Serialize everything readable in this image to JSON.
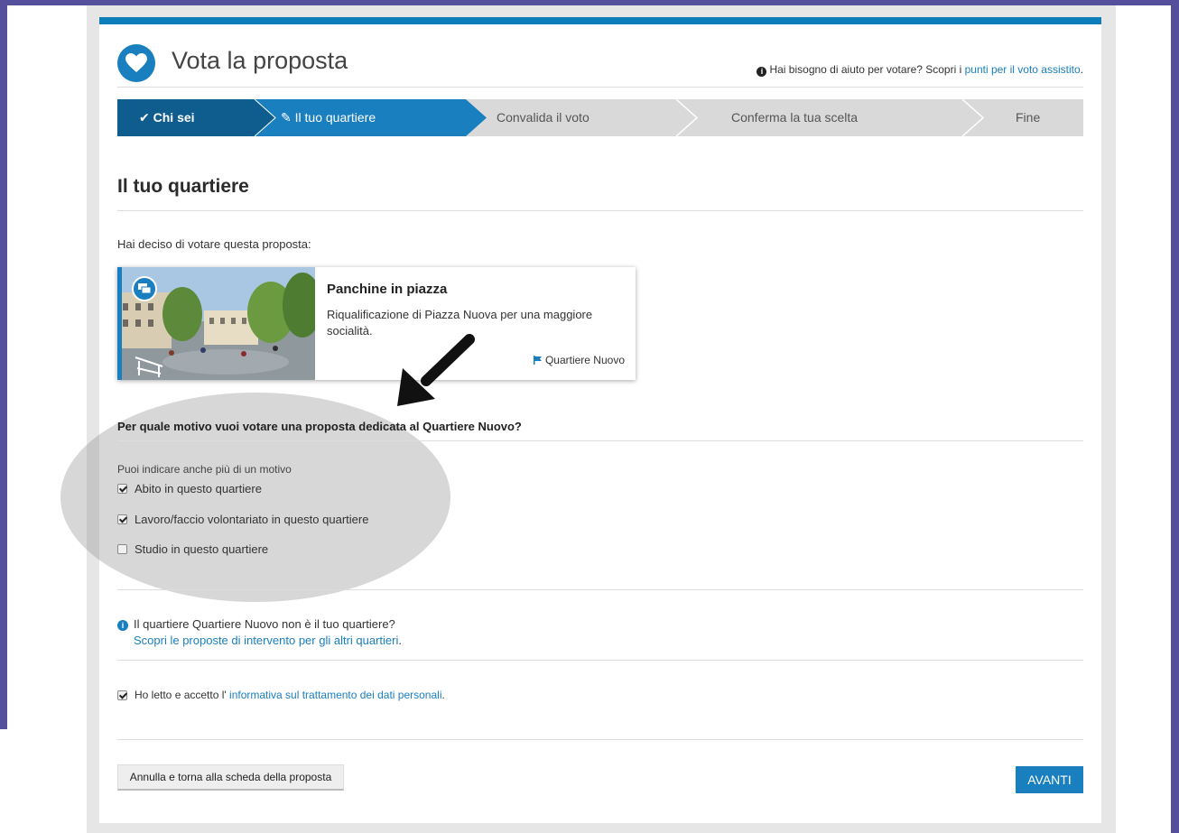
{
  "header": {
    "title": "Vota la proposta",
    "help_text": "Hai bisogno di aiuto per votare? Scopri i ",
    "help_link": "punti per il voto assistito",
    "help_suffix": "."
  },
  "steps": [
    {
      "label": "Chi sei",
      "state": "done"
    },
    {
      "label": "Il tuo quartiere",
      "state": "current"
    },
    {
      "label": "Convalida il voto",
      "state": "todo"
    },
    {
      "label": "Conferma la tua scelta",
      "state": "todo"
    },
    {
      "label": "Fine",
      "state": "todo"
    }
  ],
  "section_title": "Il tuo quartiere",
  "intro": "Hai deciso di votare questa proposta:",
  "proposal": {
    "title": "Panchine in piazza",
    "description": "Riqualificazione di Piazza Nuova per una maggiore socialità.",
    "area": "Quartiere Nuovo"
  },
  "question": {
    "title": "Per quale motivo vuoi votare una proposta dedicata al Quartiere Nuovo?",
    "hint": "Puoi indicare anche più di un motivo",
    "options": [
      {
        "label": "Abito in questo quartiere",
        "checked": true
      },
      {
        "label": "Lavoro/faccio volontariato in questo quartiere",
        "checked": true
      },
      {
        "label": "Studio in questo quartiere",
        "checked": false
      }
    ]
  },
  "other_district": {
    "text": "Il quartiere Quartiere Nuovo non è il tuo quartiere?",
    "link": "Scopri le proposte di intervento per gli altri quartieri",
    "suffix": "."
  },
  "privacy": {
    "text": "Ho letto e accetto l' ",
    "link": "informativa sul trattamento dei dati personali",
    "suffix": ".",
    "checked": true
  },
  "buttons": {
    "cancel": "Annulla e torna alla scheda della proposta",
    "next": "AVANTI"
  },
  "colors": {
    "primary": "#1a7fbf",
    "step_done": "#0f5d8e",
    "step_todo": "#d9d9d9",
    "side_bar": "#55509c"
  }
}
